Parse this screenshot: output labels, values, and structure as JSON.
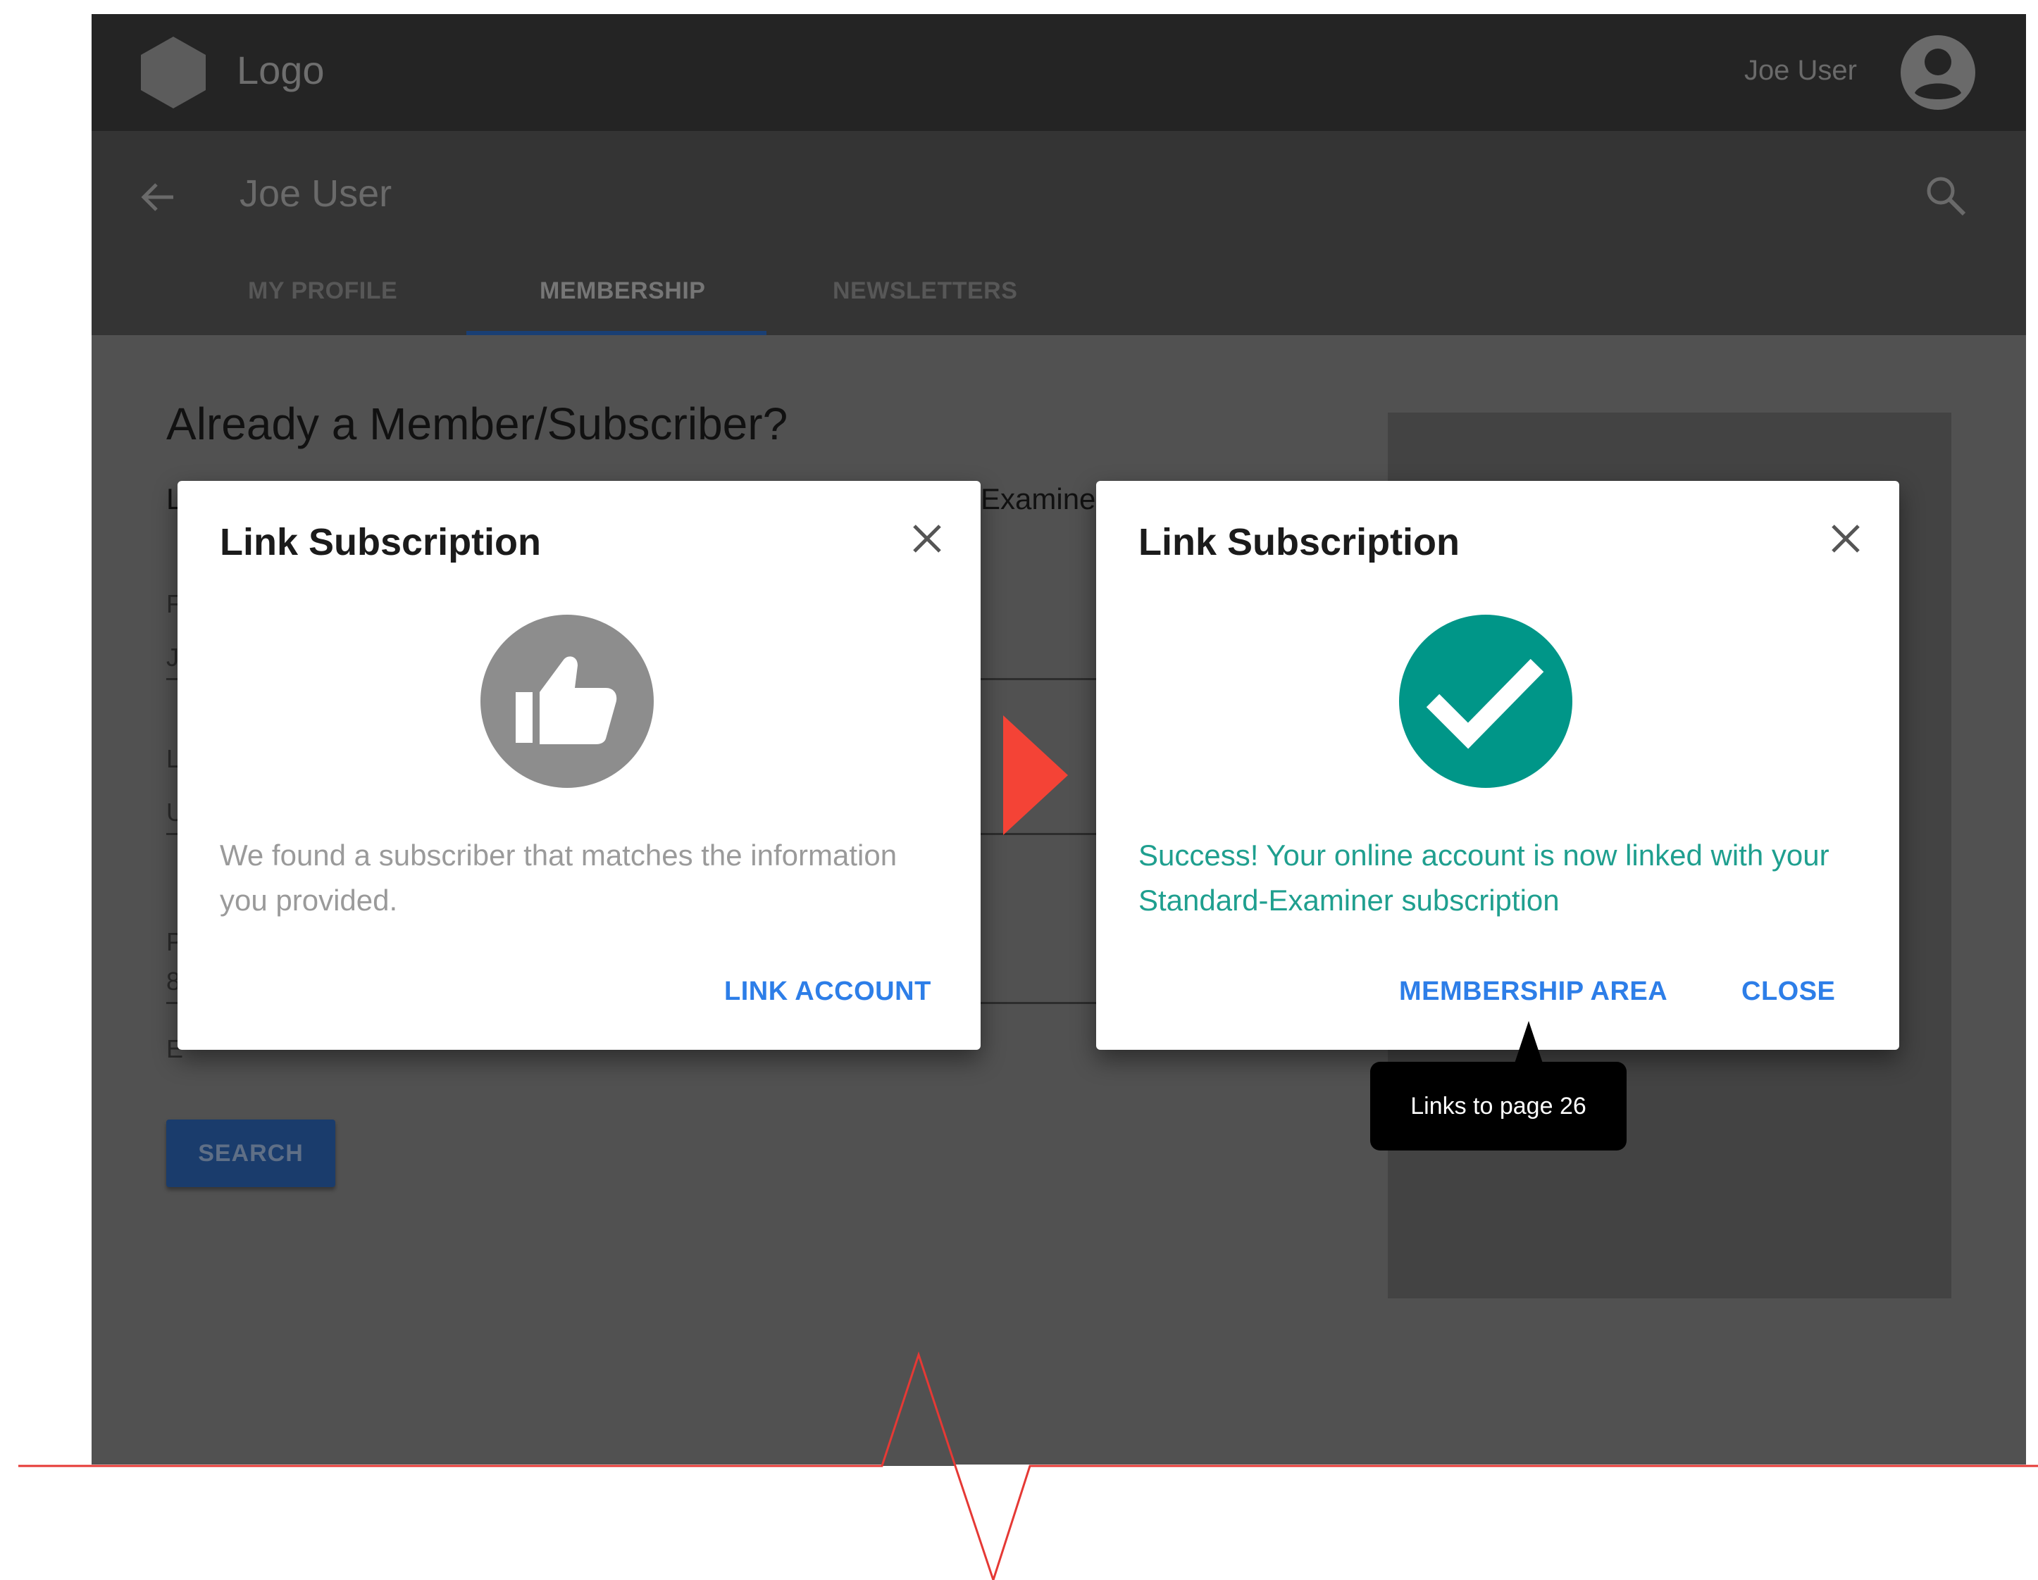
{
  "topbar": {
    "logo_text": "Logo",
    "user_name": "Joe User"
  },
  "subbar": {
    "page_title": "Joe User",
    "tabs": [
      {
        "label": "MY PROFILE",
        "active": false
      },
      {
        "label": "MEMBERSHIP",
        "active": true
      },
      {
        "label": "NEWSLETTERS",
        "active": false
      }
    ]
  },
  "content": {
    "heading": "Already a Member/Subscriber?",
    "sub_start": "L",
    "sub_end": "Examine",
    "field_glyphs": [
      "F",
      "J",
      "L",
      "U",
      "P",
      "8",
      "E"
    ],
    "search_label": "SEARCH"
  },
  "dialog_found": {
    "title": "Link Subscription",
    "message": "We found a subscriber that matches the information you provided.",
    "action_label": "LINK ACCOUNT",
    "icon": "thumbs-up-icon"
  },
  "dialog_success": {
    "title": "Link Subscription",
    "message": "Success! Your online account is now linked with your Standard-Examiner subscription",
    "primary_label": "MEMBERSHIP AREA",
    "close_label": "CLOSE",
    "icon": "check-circle-icon"
  },
  "annotation": {
    "tooltip": "Links to page 26"
  },
  "colors": {
    "accent_blue": "#2d7ee8",
    "success_teal": "#009688",
    "flow_arrow": "#f44336",
    "overlay": "#515151"
  }
}
